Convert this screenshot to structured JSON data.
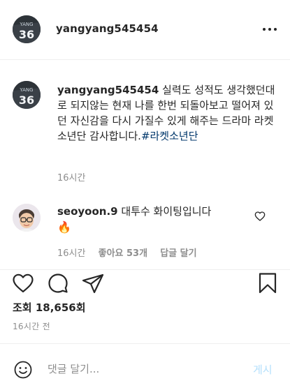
{
  "header": {
    "username": "yangyang545454",
    "avatar_jersey_name": "YANG",
    "avatar_jersey_number": "36"
  },
  "caption": {
    "username": "yangyang545454",
    "text": " 실력도 성적도 생각했던대로 되지않는 현재 나를 한번 되돌아보고 떨어져 있던 자신감을 다시 가질수 있게 해주는 드라마 라켓소년단 감사합니다.",
    "hashtag": "#라켓소년단",
    "time": "16시간"
  },
  "comment": {
    "username": "seoyoon.9",
    "text": " 대투수 화이팅입니다",
    "emoji": "🔥",
    "time": "16시간",
    "likes": "좋아요 53개",
    "reply": "답글 달기"
  },
  "post": {
    "views": "조회 18,656회",
    "time": "16시간 전"
  },
  "comment_box": {
    "placeholder": "댓글 달기...",
    "submit_label": "게시"
  },
  "icons": [
    "more-icon",
    "heart-icon",
    "comment-icon",
    "share-icon",
    "bookmark-icon",
    "emoji-icon"
  ],
  "colors": {
    "text": "#262626",
    "muted": "#8e8e8e",
    "link": "#00376b",
    "submit_disabled": "#b2dffc",
    "border": "#efefef"
  }
}
